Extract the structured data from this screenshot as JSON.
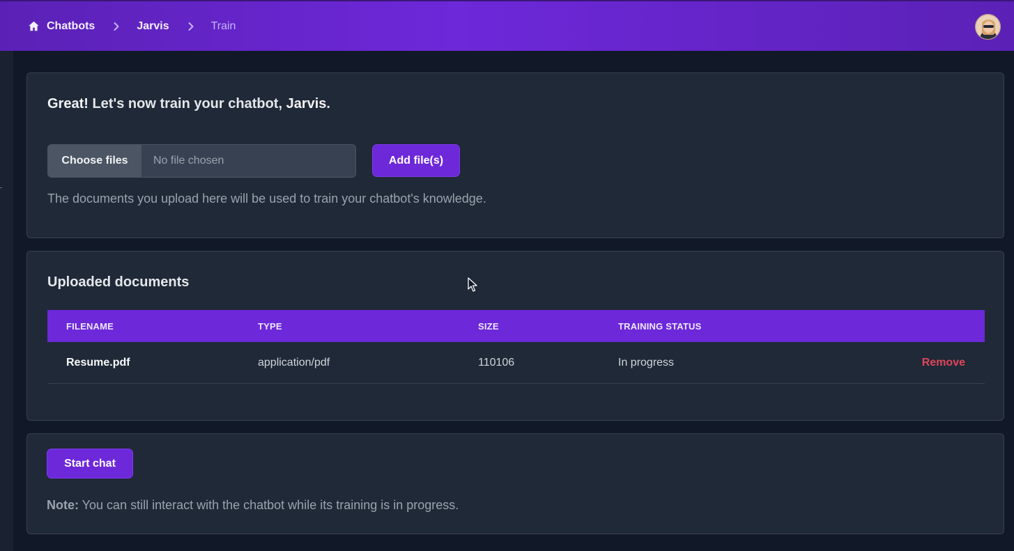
{
  "breadcrumb": {
    "home_icon": "home-icon",
    "items": [
      {
        "label": "Chatbots"
      },
      {
        "label": "Jarvis"
      },
      {
        "label": "Train"
      }
    ]
  },
  "header": {
    "avatar_icon": "user-avatar"
  },
  "train_card": {
    "headline_strong": "Great!",
    "headline_text": " Let's now train your chatbot, ",
    "bot_name": "Jarvis",
    "headline_end": ".",
    "choose_files_label": "Choose files",
    "file_status": "No file chosen",
    "add_files_label": "Add file(s)",
    "helper_text": "The documents you upload here will be used to train your chatbot's knowledge."
  },
  "documents_card": {
    "title": "Uploaded documents",
    "columns": [
      "FILENAME",
      "TYPE",
      "SIZE",
      "TRAINING STATUS"
    ],
    "rows": [
      {
        "filename": "Resume.pdf",
        "type": "application/pdf",
        "size": "110106",
        "status": "In progress",
        "action": "Remove"
      }
    ]
  },
  "chat_card": {
    "start_chat_label": "Start chat",
    "note_label": "Note:",
    "note_text": " You can still interact with the chatbot while its training is in progress."
  },
  "colors": {
    "accent": "#6d28d9",
    "background": "#111827",
    "card": "#1f2937",
    "danger": "#e0455a"
  }
}
